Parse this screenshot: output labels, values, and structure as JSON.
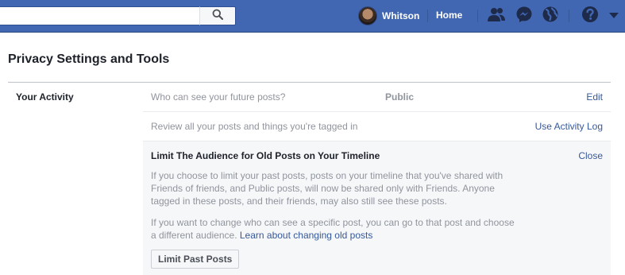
{
  "header": {
    "search": {
      "placeholder": "",
      "value": ""
    },
    "profile_name": "Whitson",
    "home_label": "Home",
    "icons": [
      "search-icon",
      "friends-icon",
      "messenger-icon",
      "globe-icon",
      "help-icon",
      "caret-down-icon"
    ]
  },
  "page": {
    "title": "Privacy Settings and Tools"
  },
  "section": {
    "label": "Your Activity",
    "rows": [
      {
        "question": "Who can see your future posts?",
        "value": "Public",
        "action": "Edit"
      },
      {
        "question": "Review all your posts and things you're tagged in",
        "value": "",
        "action": "Use Activity Log"
      }
    ],
    "panel": {
      "title": "Limit The Audience for Old Posts on Your Timeline",
      "close_label": "Close",
      "para1_lines": [
        "If you choose to limit your past posts, posts on your timeline that you've shared with",
        "Friends of friends, and Public posts, will now be shared only with Friends. Anyone",
        "tagged in these posts, and their friends, may also still see these posts."
      ],
      "para2_line1": "If you want to change who can see a specific post, you can go to that post and choose",
      "para2_line2": "a different audience. ",
      "para2_link": "Learn about changing old posts",
      "button_label": "Limit Past Posts"
    }
  },
  "colors": {
    "topbar": "#4267b2",
    "link": "#365899",
    "muted_text": "#90949c",
    "panel_bg": "#f6f7f9"
  }
}
